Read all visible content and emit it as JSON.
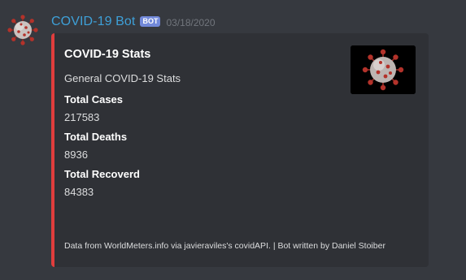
{
  "message": {
    "username": "COVID-19 Bot",
    "bot_tag": "BOT",
    "timestamp": "03/18/2020",
    "avatar_icon": "coronavirus-icon"
  },
  "embed": {
    "accent_color": "#e03d3d",
    "title": "COVID-19 Stats",
    "description": "General COVID-19 Stats",
    "thumbnail_icon": "coronavirus-icon",
    "fields": [
      {
        "name": "Total Cases",
        "value": "217583"
      },
      {
        "name": "Total Deaths",
        "value": "8936"
      },
      {
        "name": "Total Recoverd",
        "value": "84383"
      }
    ],
    "footer": "Data from WorldMeters.info via javieraviles's covidAPI. | Bot written by Daniel Stoiber"
  },
  "colors": {
    "background": "#36393f",
    "embed_background": "#2f3136",
    "username": "#3ea0d8",
    "bot_tag": "#7289da"
  }
}
